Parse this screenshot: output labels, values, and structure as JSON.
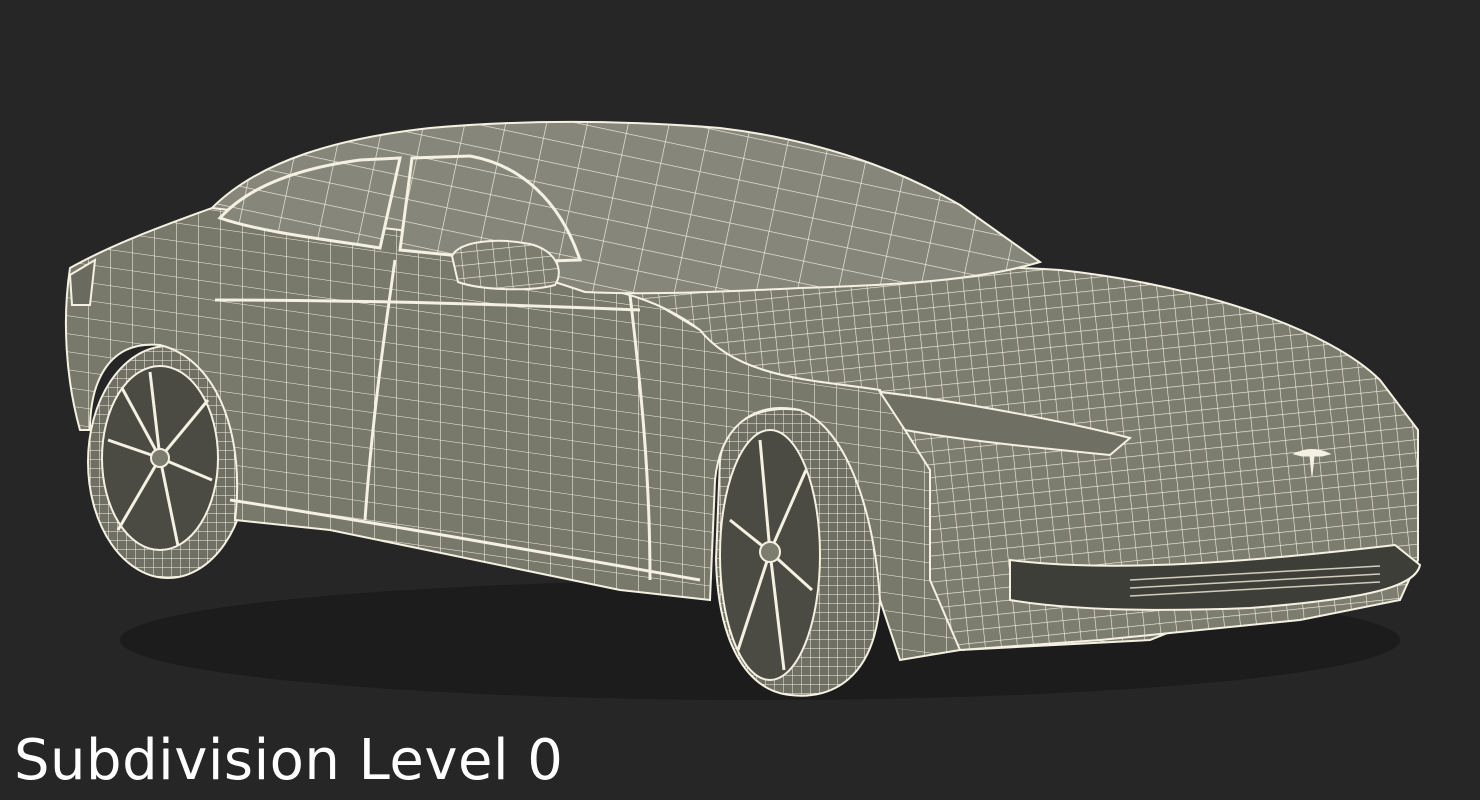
{
  "caption": {
    "text": "Subdivision Level 0"
  },
  "model": {
    "icon": "car-wireframe-icon",
    "body_color": "#7d7d6f",
    "shadow_color": "#55554b",
    "wire_color": "#f4f1e2",
    "background": "#262626"
  }
}
